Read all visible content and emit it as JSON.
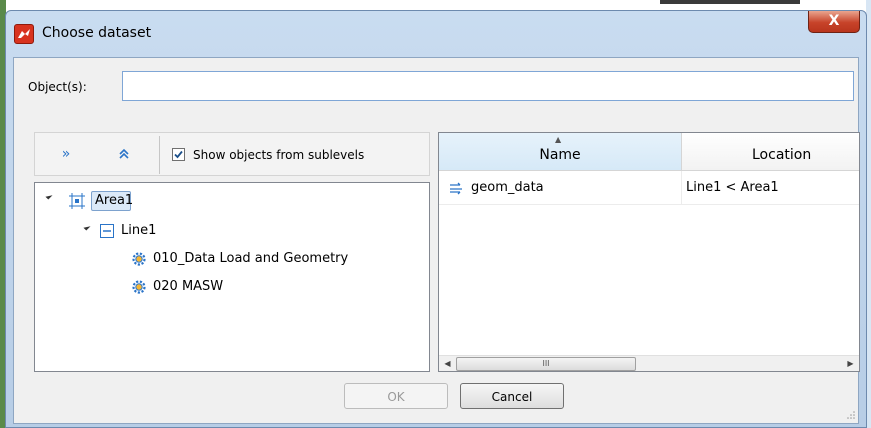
{
  "dialog": {
    "title": "Choose dataset",
    "close_label": "X"
  },
  "objects": {
    "label": "Object(s):",
    "value": "",
    "placeholder": ""
  },
  "tree_toolbar": {
    "expand_all_icon": "double-chevron-right-icon",
    "collapse_all_icon": "double-chevron-up-icon",
    "show_sublevels_label": "Show objects from sublevels",
    "show_sublevels_checked": true
  },
  "tree": {
    "nodes": [
      {
        "label": "Area1",
        "icon": "area-icon",
        "expanded": true,
        "selected": true
      },
      {
        "label": "Line1",
        "icon": "line-icon",
        "expanded": true
      },
      {
        "label": "010_Data Load and Geometry",
        "icon": "gear-icon"
      },
      {
        "label": "020 MASW",
        "icon": "gear-icon"
      }
    ]
  },
  "table": {
    "columns": [
      "Name",
      "Location"
    ],
    "sorted_column": "Name",
    "rows": [
      {
        "name": "geom_data",
        "location": "Line1 < Area1",
        "icon": "dataset-icon"
      }
    ]
  },
  "scrollbar": {
    "thumb_grip": "III"
  },
  "buttons": {
    "ok": "OK",
    "cancel": "Cancel",
    "ok_enabled": false
  },
  "colors": {
    "accent": "#2a74c8",
    "close": "#c7432a"
  }
}
